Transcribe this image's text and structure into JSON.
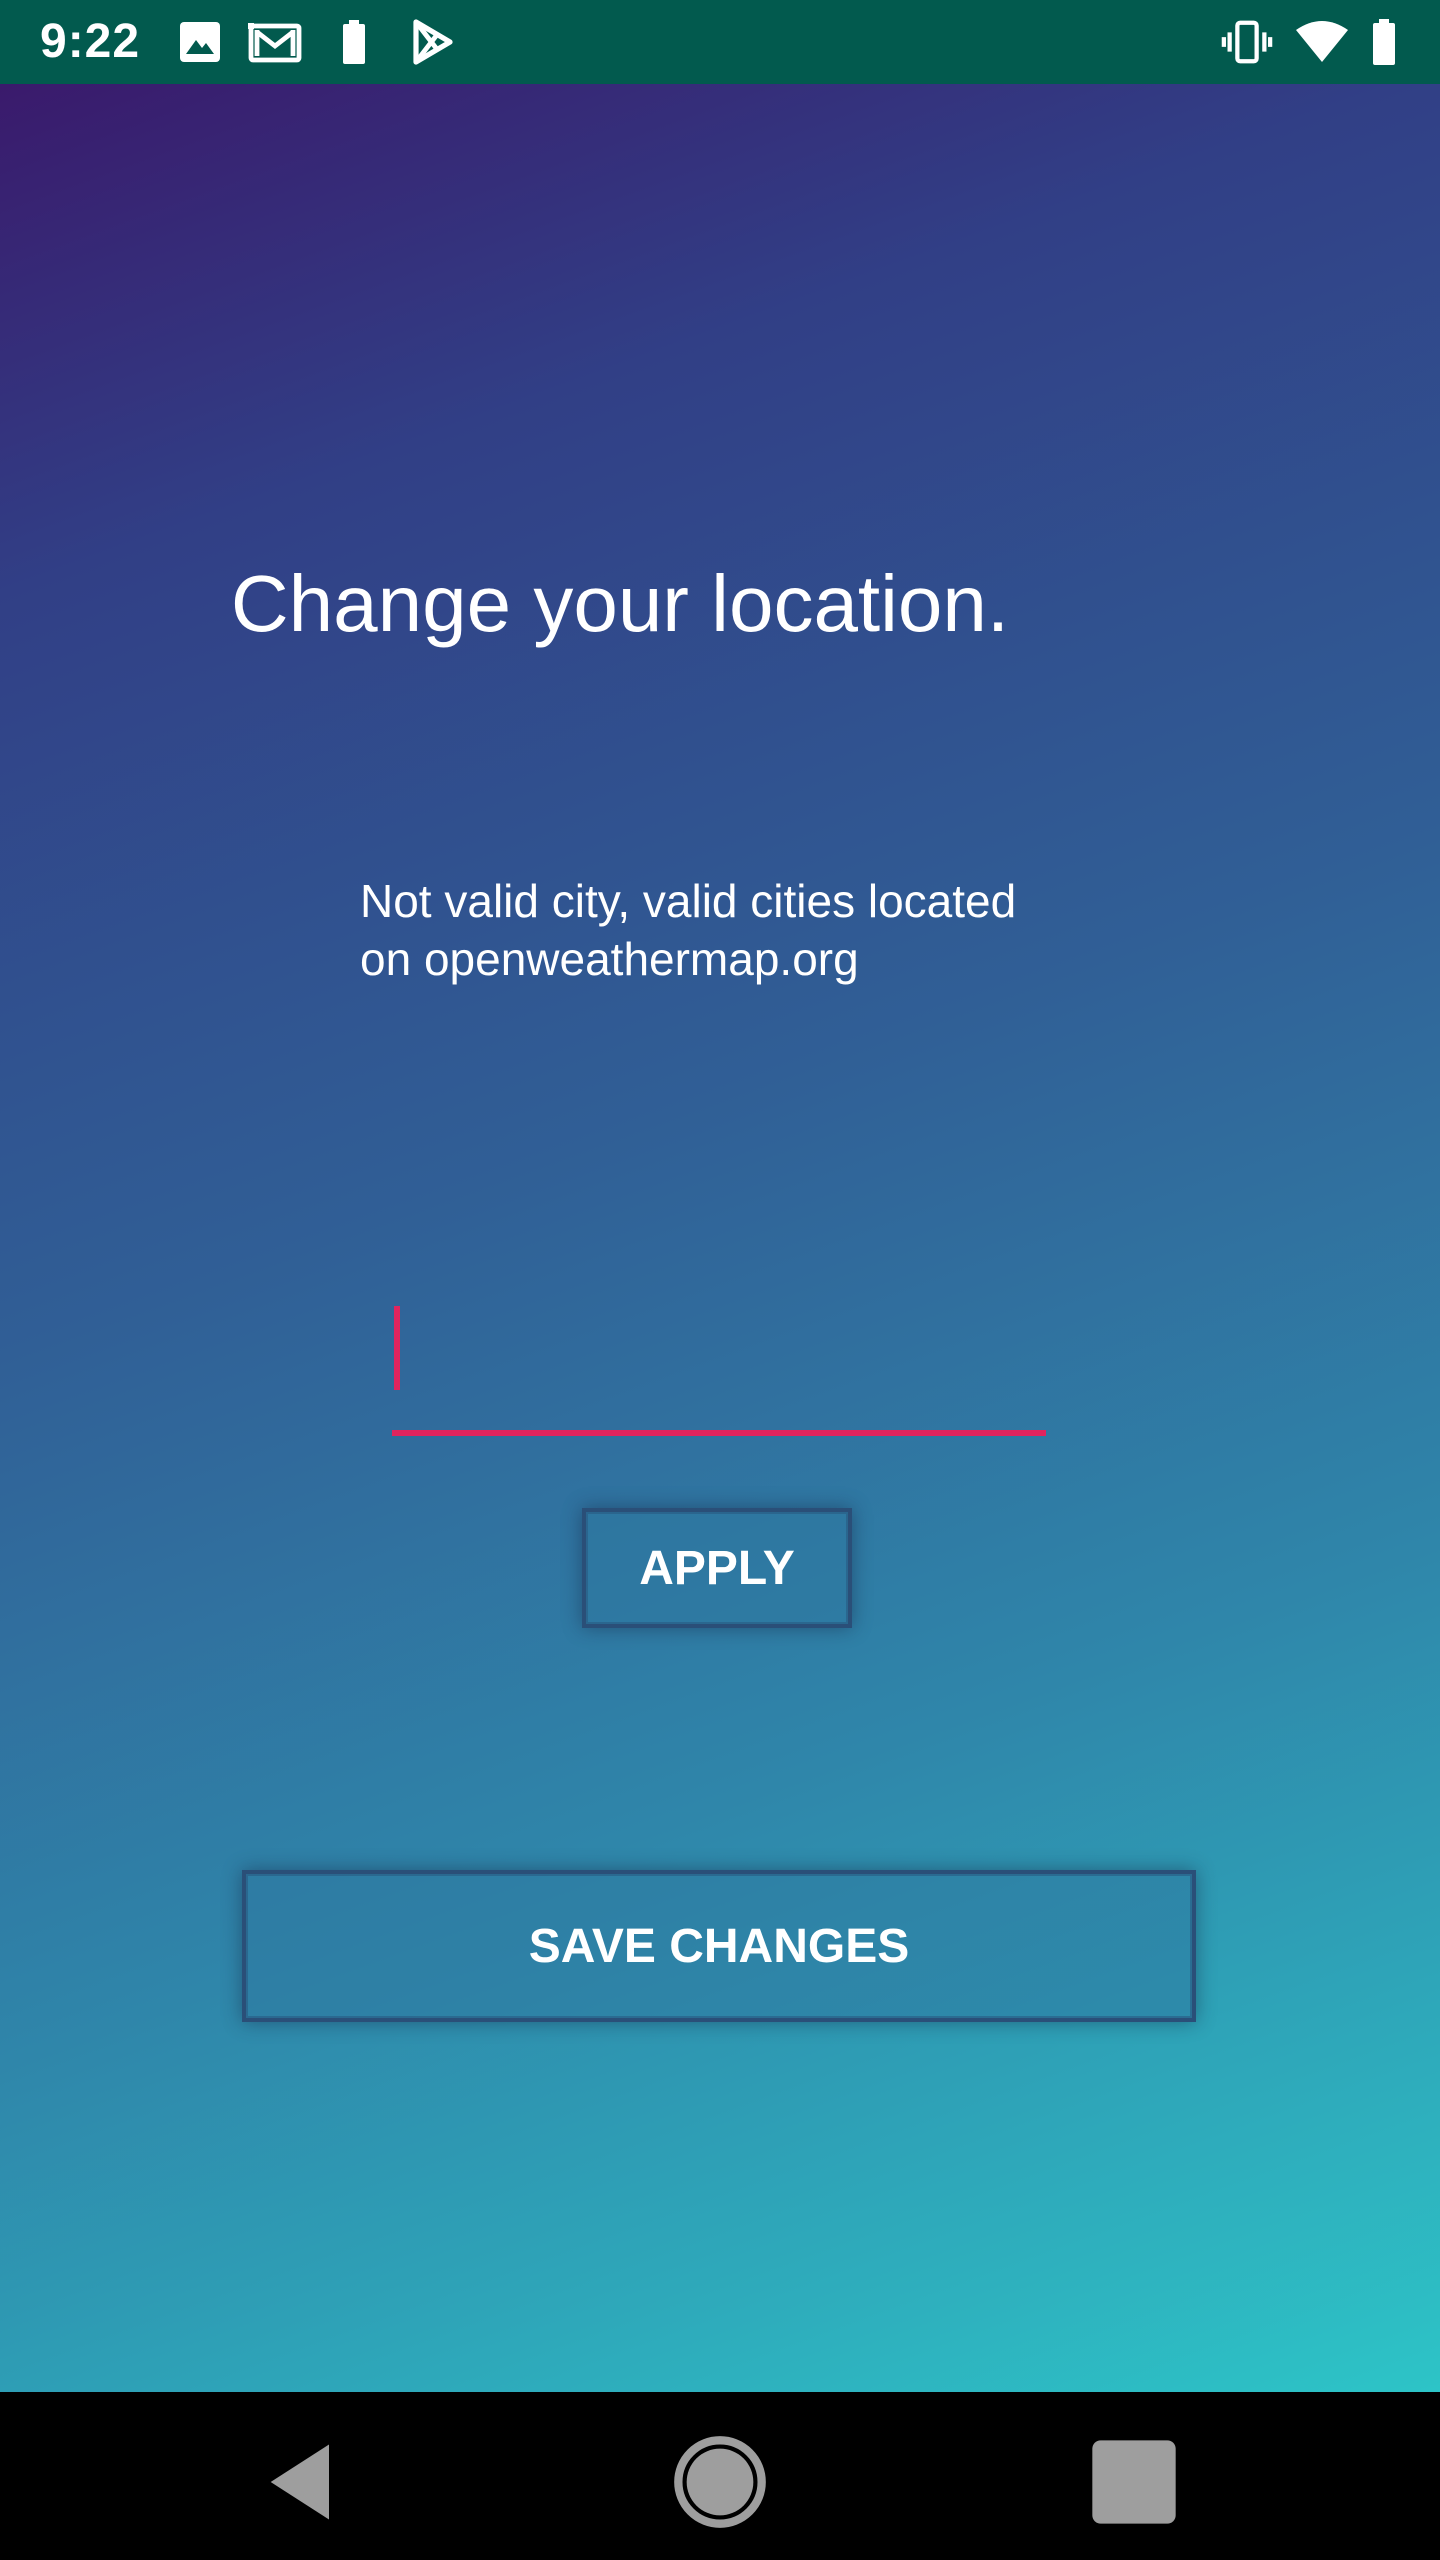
{
  "status_bar": {
    "time": "9:22",
    "left_icons": [
      "image-icon",
      "gmail-icon",
      "battery-icon",
      "play-store-icon"
    ],
    "right_icons": [
      "vibrate-icon",
      "wifi-icon",
      "battery-icon"
    ],
    "background_color": "#025a4e"
  },
  "main": {
    "title": "Change your location.",
    "message_lines": [
      "Not valid city, valid cities located",
      "on openweathermap.org"
    ],
    "city_input": {
      "value": "",
      "placeholder": ""
    },
    "apply_label": "APPLY",
    "save_label": "SAVE CHANGES",
    "accent_color": "#e0245e",
    "gradient_colors": [
      "#3a1a6c",
      "#305f96",
      "#2dc4c7"
    ]
  },
  "nav_bar": {
    "buttons": [
      "back-icon",
      "home-icon",
      "recents-icon"
    ]
  }
}
